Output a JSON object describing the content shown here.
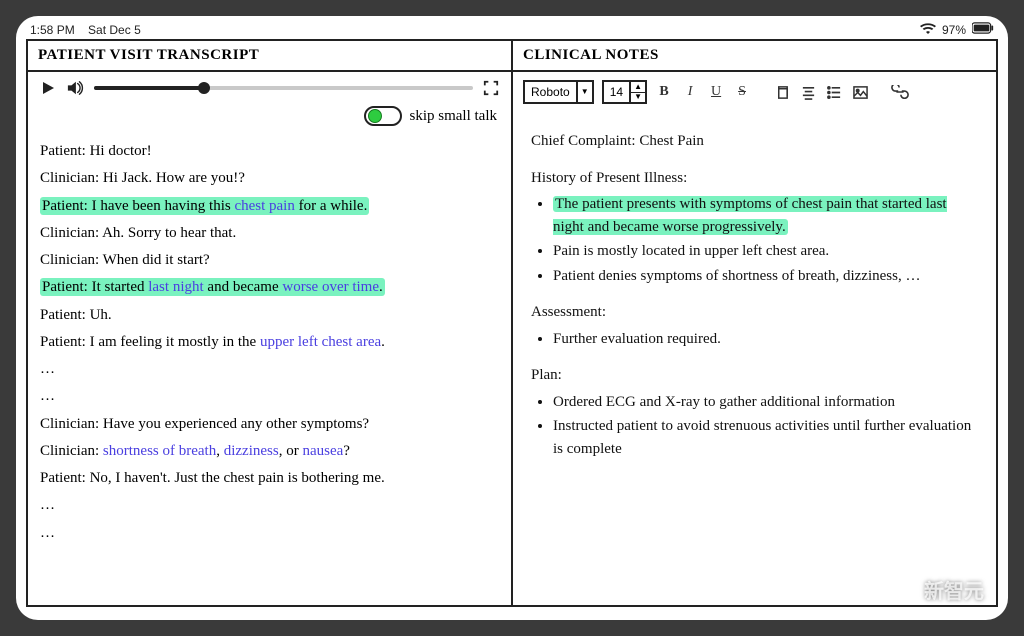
{
  "status": {
    "time": "1:58 PM",
    "date": "Sat Dec 5",
    "battery": "97%"
  },
  "left": {
    "title": "PATIENT VISIT TRANSCRIPT",
    "toggle_label": "skip small talk",
    "lines": [
      {
        "speaker": "Patient",
        "segs": [
          {
            "t": "Hi doctor!"
          }
        ],
        "hl": false
      },
      {
        "speaker": "Clinician",
        "segs": [
          {
            "t": "Hi Jack. How are you!?"
          }
        ],
        "hl": false
      },
      {
        "speaker": "Patient",
        "segs": [
          {
            "t": "I have been having this "
          },
          {
            "t": "chest pain",
            "kw": true
          },
          {
            "t": " for a while."
          }
        ],
        "hl": true
      },
      {
        "speaker": "Clinician",
        "segs": [
          {
            "t": "Ah. Sorry to hear that."
          }
        ],
        "hl": false
      },
      {
        "speaker": "Clinician",
        "segs": [
          {
            "t": "When did it start?"
          }
        ],
        "hl": false
      },
      {
        "speaker": "Patient",
        "segs": [
          {
            "t": "It started "
          },
          {
            "t": "last night",
            "kw": true
          },
          {
            "t": " and became "
          },
          {
            "t": "worse over time",
            "kw": true
          },
          {
            "t": "."
          }
        ],
        "hl": true
      },
      {
        "speaker": "Patient",
        "segs": [
          {
            "t": "Uh."
          }
        ],
        "hl": false
      },
      {
        "speaker": "Patient",
        "segs": [
          {
            "t": "I am feeling it mostly in the "
          },
          {
            "t": "upper left chest area",
            "kw": true
          },
          {
            "t": "."
          }
        ],
        "hl": false
      },
      {
        "ellipsis": true
      },
      {
        "ellipsis": true
      },
      {
        "speaker": "Clinician",
        "segs": [
          {
            "t": "Have you experienced any other symptoms?"
          }
        ],
        "hl": false
      },
      {
        "speaker": "Clinician",
        "segs": [
          {
            "t": "shortness of breath",
            "kw": true
          },
          {
            "t": ", "
          },
          {
            "t": "dizziness",
            "kw": true
          },
          {
            "t": ", or "
          },
          {
            "t": "nausea",
            "kw": true
          },
          {
            "t": "?"
          }
        ],
        "hl": false
      },
      {
        "speaker": "Patient",
        "segs": [
          {
            "t": "No, I haven't. Just the chest pain is bothering me."
          }
        ],
        "hl": false
      },
      {
        "ellipsis": true
      },
      {
        "ellipsis": true
      }
    ]
  },
  "right": {
    "title": "CLINICAL NOTES",
    "font_name": "Roboto",
    "font_size": "14",
    "chief_label": "Chief Complaint: Chest Pain",
    "hpi_label": "History of Present Illness:",
    "hpi_items": [
      {
        "t": "The patient presents with symptoms of chest pain that started last night and became worse progressively.",
        "hl": true
      },
      {
        "t": "Pain is mostly located in upper left chest area."
      },
      {
        "t": "Patient denies symptoms of shortness of breath, dizziness, …"
      }
    ],
    "assessment_label": "Assessment:",
    "assessment_items": [
      {
        "t": "Further evaluation required."
      }
    ],
    "plan_label": "Plan:",
    "plan_items": [
      {
        "t": "Ordered ECG and X-ray to gather additional information"
      },
      {
        "t": "Instructed patient to avoid strenuous activities until further evaluation is complete"
      }
    ]
  },
  "watermark": "新智元"
}
